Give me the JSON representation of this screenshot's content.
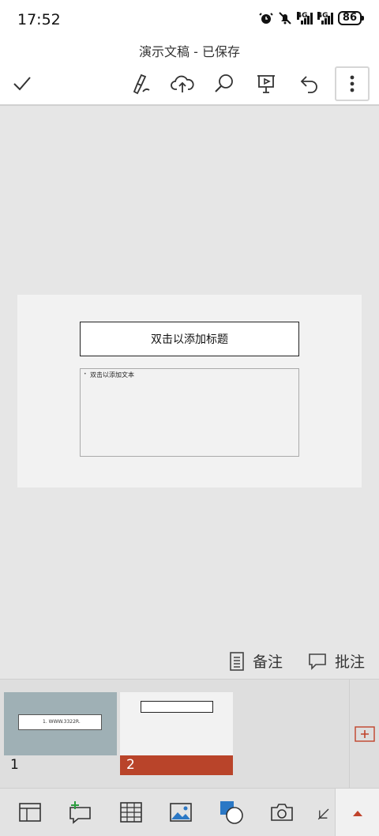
{
  "status": {
    "time": "17:52",
    "network1": "4G",
    "network2": "4G",
    "battery": "86"
  },
  "document": {
    "title": "演示文稿 - 已保存"
  },
  "slide": {
    "title_placeholder": "双击以添加标题",
    "body_placeholder": "双击以添加文本",
    "bullet": "•"
  },
  "actions": {
    "notes": "备注",
    "comments": "批注"
  },
  "thumbnails": [
    {
      "number": "1",
      "text": "1.  WWW.3322R."
    },
    {
      "number": "2"
    }
  ],
  "colors": {
    "accent": "#b9442a",
    "canvas": "#e6e6e6",
    "slide": "#f2f2f2"
  }
}
